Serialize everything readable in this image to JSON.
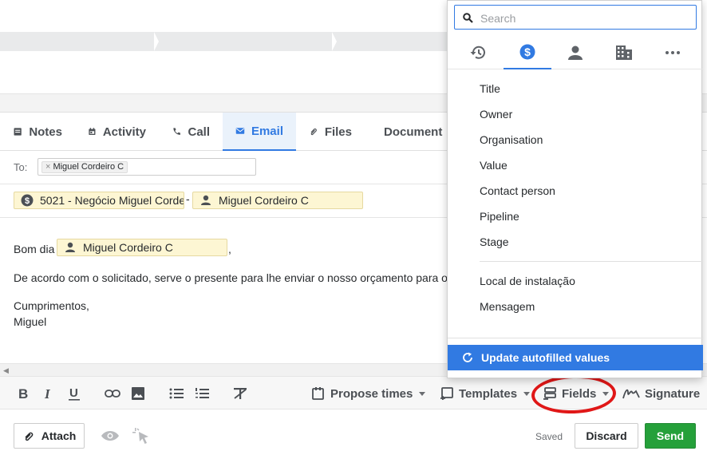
{
  "tabs": [
    {
      "label": "Notes",
      "icon": "note-icon"
    },
    {
      "label": "Activity",
      "icon": "calendar-icon"
    },
    {
      "label": "Call",
      "icon": "phone-icon"
    },
    {
      "label": "Email",
      "icon": "envelope-icon",
      "active": true
    },
    {
      "label": "Files",
      "icon": "paperclip-icon"
    },
    {
      "label": "Document",
      "icon": "document-icon"
    }
  ],
  "to": {
    "label": "To:",
    "recipient_chip": "Miguel Cordeiro C"
  },
  "deal_row": {
    "deal_token": "5021 - Negócio Miguel Corde",
    "separator": "-",
    "person_token": "Miguel Cordeiro C"
  },
  "body": {
    "greeting": "Bom dia",
    "greeting_token": "Miguel Cordeiro C",
    "greeting_comma": ",",
    "paragraph": "De acordo com o solicitado, serve o presente para lhe enviar o nosso orçamento para o",
    "closing": "Cumprimentos,",
    "signature": "Miguel"
  },
  "toolbar": {
    "propose_times": "Propose times",
    "templates": "Templates",
    "fields": "Fields",
    "signature": "Signature"
  },
  "footer": {
    "attach": "Attach",
    "saved": "Saved",
    "discard": "Discard",
    "send": "Send"
  },
  "popover": {
    "search_placeholder": "Search",
    "categories": [
      "history-icon",
      "dollar-icon",
      "person-icon",
      "building-icon",
      "more-icon"
    ],
    "active_category": "dollar-icon",
    "fields": [
      "Title",
      "Owner",
      "Organisation",
      "Value",
      "Contact person",
      "Pipeline",
      "Stage"
    ],
    "custom_fields": [
      "Local de instalação",
      "Mensagem"
    ],
    "update_button": "Update autofilled values"
  },
  "colors": {
    "accent": "#317ae2",
    "send": "#25a03a",
    "token_bg": "#fdf6d3",
    "annotation": "#e01717"
  }
}
